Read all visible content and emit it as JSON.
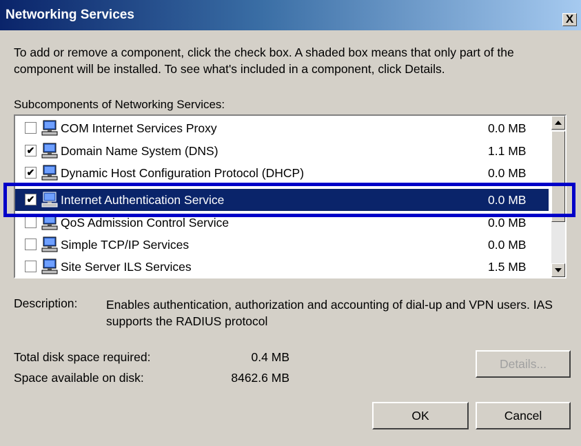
{
  "window": {
    "title": "Networking Services",
    "close_glyph": "X"
  },
  "intro": "To add or remove a component, click the check box. A shaded box means that only part of the component will be installed. To see what's included in a component, click Details.",
  "list": {
    "label": "Subcomponents of Networking Services:",
    "items": [
      {
        "label": "COM Internet Services Proxy",
        "size": "0.0 MB",
        "checked": false,
        "check_glyph": ""
      },
      {
        "label": "Domain Name System (DNS)",
        "size": "1.1 MB",
        "checked": true,
        "check_glyph": "✔"
      },
      {
        "label": "Dynamic Host Configuration Protocol (DHCP)",
        "size": "0.0 MB",
        "checked": true,
        "check_glyph": "✔"
      },
      {
        "label": "Internet Authentication Service",
        "size": "0.0 MB",
        "checked": true,
        "check_glyph": "✔",
        "selected": true
      },
      {
        "label": "QoS Admission Control Service",
        "size": "0.0 MB",
        "checked": false,
        "check_glyph": ""
      },
      {
        "label": "Simple TCP/IP Services",
        "size": "0.0 MB",
        "checked": false,
        "check_glyph": ""
      },
      {
        "label": "Site Server ILS Services",
        "size": "1.5 MB",
        "checked": false,
        "check_glyph": ""
      }
    ]
  },
  "description": {
    "label": "Description:",
    "text": "Enables authentication, authorization and accounting of dial-up and VPN users. IAS supports the RADIUS protocol"
  },
  "disk": {
    "required_label": "Total disk space required:",
    "required_value": "0.4 MB",
    "available_label": "Space available on disk:",
    "available_value": "8462.6 MB"
  },
  "buttons": {
    "details": "Details...",
    "ok": "OK",
    "cancel": "Cancel"
  },
  "colors": {
    "titlebar_start": "#0a246a",
    "titlebar_end": "#a6caf0",
    "selection": "#0a246a",
    "highlight_box": "#0000c8"
  },
  "icons": {
    "item_icon": "network-computer-icon",
    "scroll_up": "arrow-up-icon",
    "scroll_down": "arrow-down-icon"
  }
}
